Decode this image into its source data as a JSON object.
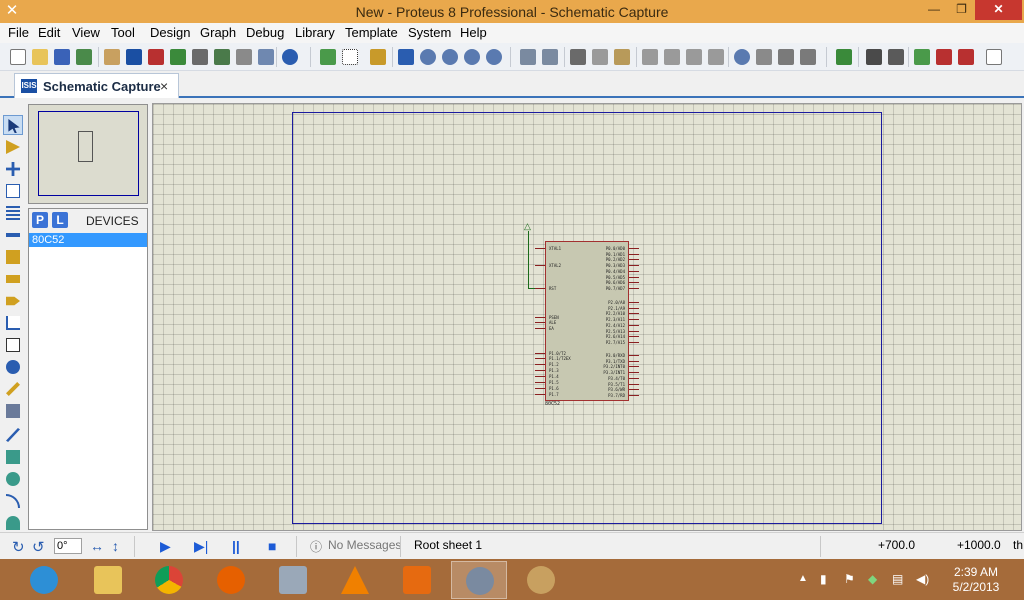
{
  "window": {
    "title": "New - Proteus 8 Professional - Schematic Capture"
  },
  "menu": [
    "File",
    "Edit",
    "View",
    "Tool",
    "Design",
    "Graph",
    "Debug",
    "Library",
    "Template",
    "System",
    "Help"
  ],
  "tab": {
    "label": "Schematic Capture",
    "icon_text": "ISIS"
  },
  "devices": {
    "p_label": "P",
    "l_label": "L",
    "title": "DEVICES",
    "items": [
      "80C52"
    ]
  },
  "schematic": {
    "chip_name": "80C52",
    "left_pins": [
      "XTAL1",
      "XTAL2",
      "RST",
      "PSEN",
      "ALE",
      "EA",
      "P1.0/T2",
      "P1.1/T2EX",
      "P1.2",
      "P1.3",
      "P1.4",
      "P1.5",
      "P1.6",
      "P1.7"
    ],
    "right_pins": [
      "P0.0/AD0",
      "P0.1/AD1",
      "P0.2/AD2",
      "P0.3/AD3",
      "P0.4/AD4",
      "P0.5/AD5",
      "P0.6/AD6",
      "P0.7/AD7",
      "P2.0/A8",
      "P2.1/A9",
      "P2.2/A10",
      "P2.3/A11",
      "P2.4/A12",
      "P2.5/A13",
      "P2.6/A14",
      "P2.7/A15",
      "P3.0/RXD",
      "P3.1/TXD",
      "P3.2/INT0",
      "P3.3/INT1",
      "P3.4/T0",
      "P3.5/T1",
      "P3.6/WR",
      "P3.7/RD"
    ]
  },
  "status": {
    "rotation": "0°",
    "messages": "No Messages",
    "sheet": "Root sheet 1",
    "x": "+700.0",
    "y": "+1000.0",
    "unit": "th"
  },
  "taskbar": {
    "time": "2:39 AM",
    "date": "5/2/2013",
    "apps": [
      "internet-explorer",
      "file-explorer",
      "chrome",
      "firefox",
      "calculator",
      "vlc",
      "micromax",
      "proteus",
      "paint"
    ]
  },
  "colors": {
    "titlebar": "#e9a84c",
    "taskbar": "#a56b3a",
    "sheet_border": "#1b1b9f",
    "chip_fill": "#c7c8b1",
    "device_highlight": "#3399ff"
  }
}
